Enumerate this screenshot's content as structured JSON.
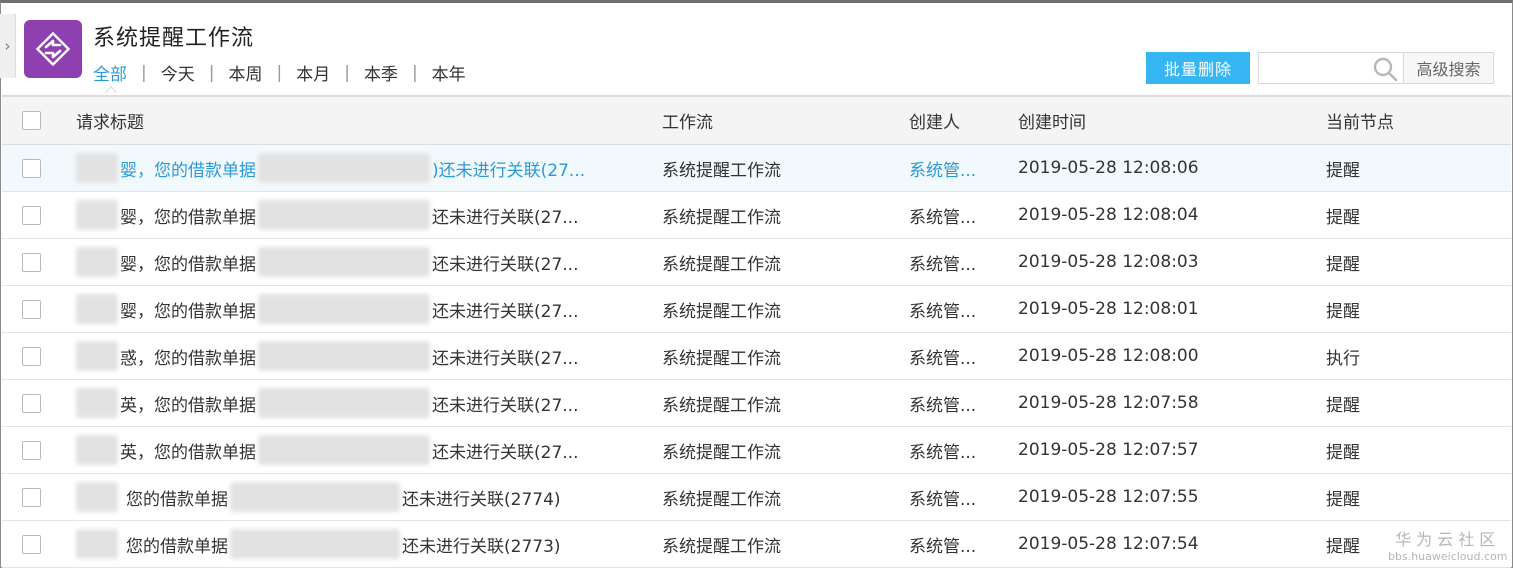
{
  "header": {
    "title": "系统提醒工作流",
    "tabs": [
      "全部",
      "今天",
      "本周",
      "本月",
      "本季",
      "本年"
    ],
    "active_tab": "全部",
    "separator": "|"
  },
  "toolbar": {
    "batch_delete_label": "批量删除",
    "search_value": "",
    "advanced_search_label": "高级搜索"
  },
  "table": {
    "columns": {
      "title": "请求标题",
      "workflow": "工作流",
      "creator": "创建人",
      "created_at": "创建时间",
      "current_node": "当前节点"
    },
    "rows": [
      {
        "title_a": "婴，您的借款单据",
        "title_b": ")还未进行关联(27...",
        "workflow": "系统提醒工作流",
        "creator": "系统管...",
        "created_at": "2019-05-28 12:08:06",
        "current_node": "提醒"
      },
      {
        "title_a": "婴，您的借款单据",
        "title_b": "还未进行关联(27...",
        "workflow": "系统提醒工作流",
        "creator": "系统管...",
        "created_at": "2019-05-28 12:08:04",
        "current_node": "提醒"
      },
      {
        "title_a": "婴，您的借款单据",
        "title_b": "还未进行关联(27...",
        "workflow": "系统提醒工作流",
        "creator": "系统管...",
        "created_at": "2019-05-28 12:08:03",
        "current_node": "提醒"
      },
      {
        "title_a": "婴，您的借款单据",
        "title_b": "还未进行关联(27...",
        "workflow": "系统提醒工作流",
        "creator": "系统管...",
        "created_at": "2019-05-28 12:08:01",
        "current_node": "提醒"
      },
      {
        "title_a": "惑，您的借款单据",
        "title_b": "还未进行关联(27...",
        "workflow": "系统提醒工作流",
        "creator": "系统管...",
        "created_at": "2019-05-28 12:08:00",
        "current_node": "执行"
      },
      {
        "title_a": "英，您的借款单据",
        "title_b": "还未进行关联(27...",
        "workflow": "系统提醒工作流",
        "creator": "系统管...",
        "created_at": "2019-05-28 12:07:58",
        "current_node": "提醒"
      },
      {
        "title_a": "英，您的借款单据",
        "title_b": "还未进行关联(27...",
        "workflow": "系统提醒工作流",
        "creator": "系统管...",
        "created_at": "2019-05-28 12:07:57",
        "current_node": "提醒"
      },
      {
        "title_a": "您的借款单据",
        "title_b": "还未进行关联(2774)",
        "workflow": "系统提醒工作流",
        "creator": "系统管...",
        "created_at": "2019-05-28 12:07:55",
        "current_node": "提醒"
      },
      {
        "title_a": "您的借款单据",
        "title_b": "还未进行关联(2773)",
        "workflow": "系统提醒工作流",
        "creator": "系统管...",
        "created_at": "2019-05-28 12:07:54",
        "current_node": "提醒"
      }
    ]
  },
  "watermark": {
    "main": "华为云社区",
    "sub": "bbs.huaweicloud.com"
  },
  "colors": {
    "accent": "#2a9ad6",
    "button": "#35b6f3",
    "app_icon": "#8e3fb0",
    "row_highlight": "#f2f9fd"
  },
  "icons": {
    "app": "sync-arrows-icon",
    "search": "search-icon",
    "sidebar": "chevron-right-icon"
  }
}
